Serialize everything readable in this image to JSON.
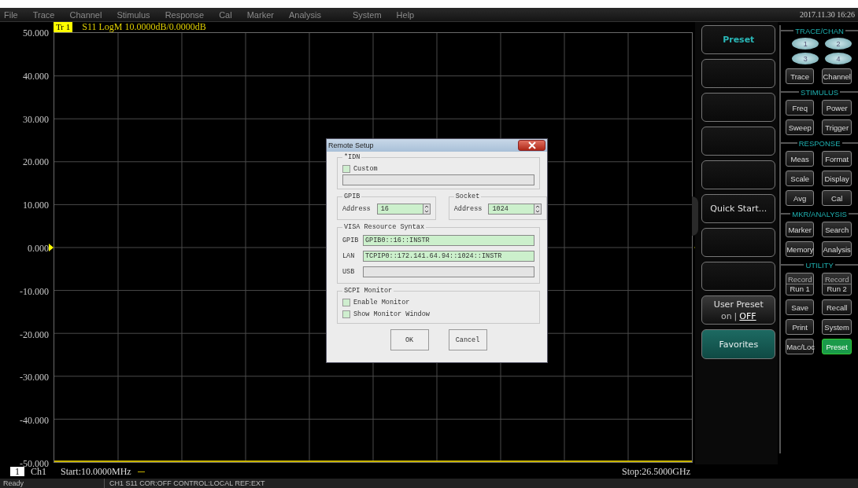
{
  "menu": [
    "File",
    "Trace",
    "Channel",
    "Stimulus",
    "Response",
    "Cal",
    "Marker",
    "Analysis",
    "System",
    "Help"
  ],
  "datetime": "2017.11.30 16:26",
  "trace_header": {
    "tag": "Tr 1",
    "text": "S11 LogM 10.0000dB/0.0000dB"
  },
  "y_axis_labels": [
    "50.000",
    "40.000",
    "30.000",
    "20.000",
    "10.000",
    "0.000",
    "-10.000",
    "-20.000",
    "-30.000",
    "-40.000",
    "-50.000"
  ],
  "softkeys": [
    {
      "kind": "title",
      "label": "Preset"
    },
    {
      "kind": "blank"
    },
    {
      "kind": "blank"
    },
    {
      "kind": "blank"
    },
    {
      "kind": "blank"
    },
    {
      "kind": "plain",
      "label": "Quick Start..."
    },
    {
      "kind": "blank"
    },
    {
      "kind": "blank"
    },
    {
      "kind": "toggle",
      "label": "User Preset",
      "separator": "|",
      "options": [
        {
          "label": "on",
          "selected": false
        },
        {
          "label": "OFF",
          "selected": true
        }
      ]
    },
    {
      "kind": "accent",
      "label": "Favorites"
    }
  ],
  "hardkeys": [
    {
      "title": "TRACE/CHAN",
      "circles": [
        "1",
        "2",
        "3",
        "4"
      ],
      "buttons": [
        {
          "label": "Trace",
          "highlighted": false
        },
        {
          "label": "Channel",
          "highlighted": false
        }
      ]
    },
    {
      "title": "STIMULUS",
      "buttons": [
        {
          "label": "Freq",
          "highlighted": false
        },
        {
          "label": "Power",
          "highlighted": false
        },
        {
          "label": "Sweep",
          "highlighted": false
        },
        {
          "label": "Trigger",
          "highlighted": false
        }
      ]
    },
    {
      "title": "RESPONSE",
      "buttons": [
        {
          "label": "Meas",
          "highlighted": false
        },
        {
          "label": "Format",
          "highlighted": false
        },
        {
          "label": "Scale",
          "highlighted": false
        },
        {
          "label": "Display",
          "highlighted": false
        },
        {
          "label": "Avg",
          "highlighted": false
        },
        {
          "label": "Cal",
          "highlighted": false
        }
      ]
    },
    {
      "title": "MKR/ANALYSIS",
      "buttons": [
        {
          "label": "Marker",
          "highlighted": false
        },
        {
          "label": "Search",
          "highlighted": false
        },
        {
          "label": "Memory",
          "highlighted": false
        },
        {
          "label": "Analysis",
          "highlighted": false
        }
      ]
    },
    {
      "title": "UTILITY",
      "buttons": [
        {
          "label": "Record",
          "sub": "Run 1",
          "highlighted": false
        },
        {
          "label": "Record",
          "sub": "Run 2",
          "highlighted": false
        },
        {
          "label": "Save",
          "highlighted": false
        },
        {
          "label": "Recall",
          "highlighted": false
        },
        {
          "label": "Print",
          "highlighted": false
        },
        {
          "label": "System",
          "highlighted": false
        },
        {
          "label": "Mac/Loc",
          "highlighted": false
        },
        {
          "label": "Preset",
          "highlighted": true
        }
      ]
    }
  ],
  "channel_bar": {
    "number": "1",
    "channel": "Ch1",
    "start": "Start:10.0000MHz",
    "stop": "Stop:26.5000GHz"
  },
  "status_bar": [
    "Ready",
    "CH1  S11  COR:OFF  CONTROL:LOCAL  REF:EXT"
  ],
  "dialog": {
    "title": "Remote Setup",
    "idn": {
      "title": "*IDN",
      "custom": {
        "label": "Custom",
        "checked": false
      }
    },
    "gpib": {
      "title": "GPIB",
      "label": "Address",
      "value": "16"
    },
    "socket": {
      "title": "Socket",
      "label": "Address",
      "value": "1024"
    },
    "visa": {
      "title": "VISA Resource Syntax",
      "rows": [
        {
          "label": "GPIB",
          "value": "GPIB0::16::INSTR",
          "disabled": false
        },
        {
          "label": "LAN",
          "value": "TCPIP0::172.141.64.94::1024::INSTR",
          "disabled": false
        },
        {
          "label": "USB",
          "disabled": true
        }
      ]
    },
    "scpi": {
      "title": "SCPI Monitor",
      "options": [
        {
          "label": "Enable Monitor",
          "checked": false
        },
        {
          "label": "Show Monitor Window",
          "checked": false
        }
      ]
    },
    "buttons": [
      "OK",
      "Cancel"
    ]
  }
}
